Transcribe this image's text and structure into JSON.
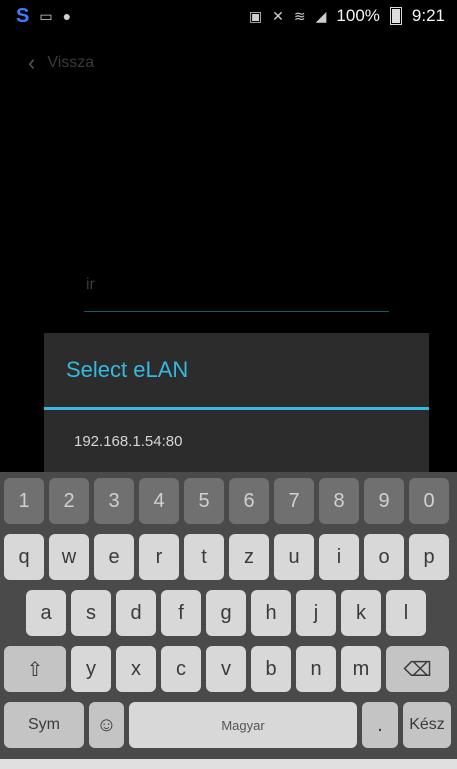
{
  "status": {
    "battery_percent": "100%",
    "time": "9:21",
    "left_icons": [
      "s-app-icon",
      "keyboard-icon",
      "aep-icon"
    ],
    "right_icons": [
      "screen-mirror-icon",
      "mute-icon",
      "wifi-icon",
      "signal-icon",
      "battery-icon"
    ]
  },
  "nav": {
    "back_label": "Vissza"
  },
  "input": {
    "value": "ir"
  },
  "dialog": {
    "title": "Select eLAN",
    "items": [
      "192.168.1.54:80"
    ]
  },
  "keyboard": {
    "row_numbers": [
      "1",
      "2",
      "3",
      "4",
      "5",
      "6",
      "7",
      "8",
      "9",
      "0"
    ],
    "row1": [
      "q",
      "w",
      "e",
      "r",
      "t",
      "z",
      "u",
      "i",
      "o",
      "p"
    ],
    "row2": [
      "a",
      "s",
      "d",
      "f",
      "g",
      "h",
      "j",
      "k",
      "l"
    ],
    "row3_letters": [
      "y",
      "x",
      "c",
      "v",
      "b",
      "n",
      "m"
    ],
    "shift_label": "⇧",
    "backspace_label": "⌫",
    "sym_label": "Sym",
    "emoji_label": "☺",
    "space_label": "Magyar",
    "dot_label": ".",
    "done_label": "Kész"
  }
}
